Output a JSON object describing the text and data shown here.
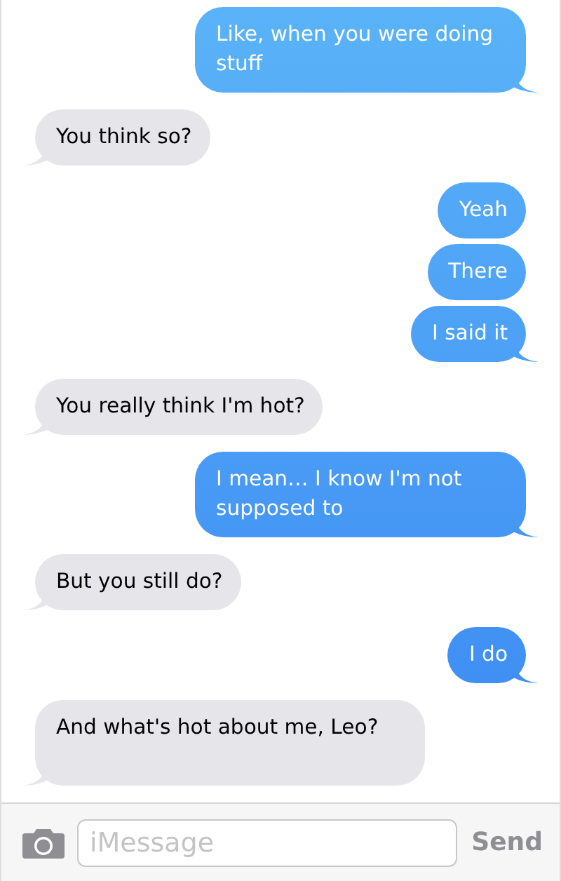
{
  "messages": [
    {
      "text": "Like, when you were doing stuff",
      "sent": true,
      "tail": true
    },
    {
      "text": "You think so?",
      "sent": false,
      "tail": true
    },
    {
      "text": "Yeah",
      "sent": true,
      "tail": false
    },
    {
      "text": "There",
      "sent": true,
      "tail": false
    },
    {
      "text": "I said it",
      "sent": true,
      "tail": true
    },
    {
      "text": "You really think I'm hot?",
      "sent": false,
      "tail": true
    },
    {
      "text": "I mean… I know I'm not supposed to",
      "sent": true,
      "tail": true
    },
    {
      "text": "But you still do?",
      "sent": false,
      "tail": true
    },
    {
      "text": "I do",
      "sent": true,
      "tail": true
    },
    {
      "text": "And what's hot about me, Leo?",
      "sent": false,
      "tail": true
    }
  ],
  "composer": {
    "placeholder": "iMessage",
    "send": "Send"
  }
}
